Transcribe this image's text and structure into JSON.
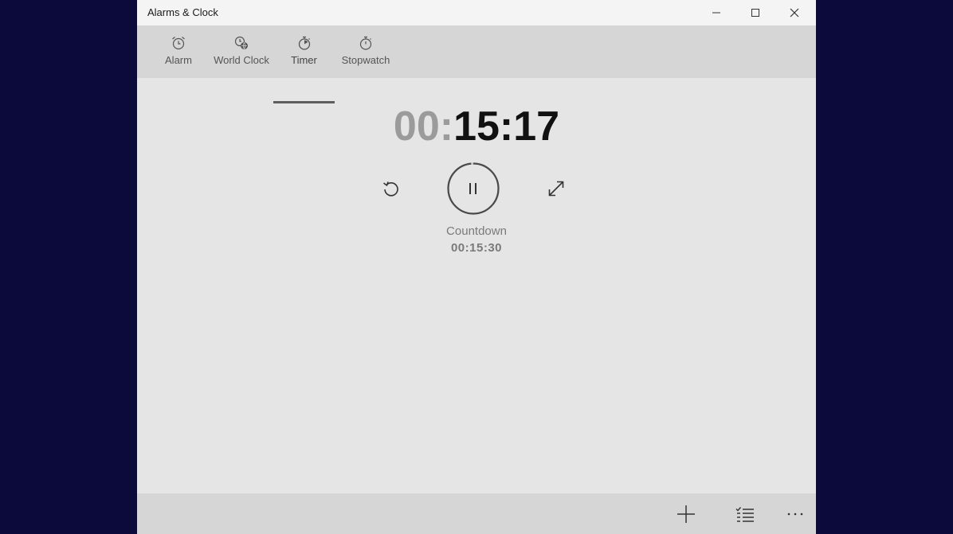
{
  "window": {
    "title": "Alarms & Clock"
  },
  "tabs": [
    {
      "label": "Alarm",
      "icon": "alarm-clock-icon",
      "active": false
    },
    {
      "label": "World Clock",
      "icon": "world-clock-icon",
      "active": false
    },
    {
      "label": "Timer",
      "icon": "timer-icon",
      "active": true
    },
    {
      "label": "Stopwatch",
      "icon": "stopwatch-icon",
      "active": false
    }
  ],
  "timer": {
    "hours": "00",
    "sep1": ":",
    "minutes": "15",
    "sep2": ":",
    "seconds": "17",
    "name": "Countdown",
    "duration": "00:15:30",
    "progress_remaining_fraction": 0.984
  },
  "colors": {
    "background_outside": "#0b0a3a",
    "app_background": "#e5e5e5",
    "tabbar": "#d6d6d6",
    "dim_digits": "#9b9b9b",
    "active_digits": "#111111"
  }
}
